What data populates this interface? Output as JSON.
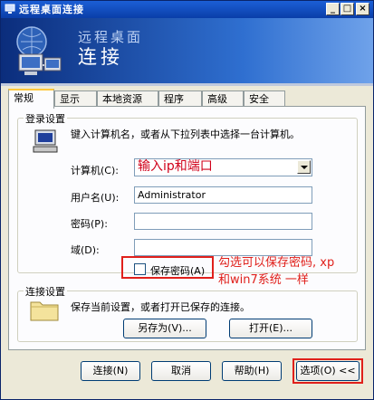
{
  "window": {
    "title": "远程桌面连接"
  },
  "banner": {
    "subtitle": "远程桌面",
    "title": "连接"
  },
  "tabs": [
    {
      "label": "常规",
      "active": true
    },
    {
      "label": "显示"
    },
    {
      "label": "本地资源"
    },
    {
      "label": "程序"
    },
    {
      "label": "高级"
    },
    {
      "label": "安全"
    }
  ],
  "login": {
    "legend": "登录设置",
    "instruction": "键入计算机名，或者从下拉列表中选择一台计算机。",
    "computer_label": "计算机(C):",
    "computer_value": "输入ip和端口",
    "username_label": "用户名(U):",
    "username_value": "Administrator",
    "password_label": "密码(P):",
    "password_value": "",
    "domain_label": "域(D):",
    "domain_value": "",
    "save_password_label": "保存密码(A)",
    "save_password_checked": false
  },
  "connection": {
    "legend": "连接设置",
    "instruction": "保存当前设置，或者打开已保存的连接。",
    "save_as_label": "另存为(V)...",
    "open_label": "打开(E)..."
  },
  "annotation": {
    "line1": "勾选可以保存密码, xp",
    "line2": "和win7系统 一样"
  },
  "footer": {
    "connect_label": "连接(N)",
    "cancel_label": "取消",
    "help_label": "帮助(H)",
    "options_label": "选项(O) <<"
  },
  "colors": {
    "annotation": "#e0201b",
    "titlebar": "#0a3ea8"
  },
  "icons": [
    "computer-network-icon",
    "computer-icon",
    "folder-icon",
    "app-icon"
  ]
}
